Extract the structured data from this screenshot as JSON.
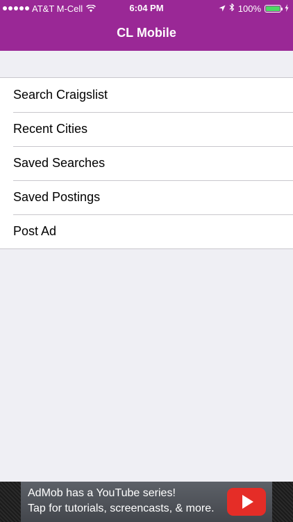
{
  "status_bar": {
    "carrier": "AT&T M-Cell",
    "time": "6:04 PM",
    "battery_percent": "100%",
    "battery_level": 1.0,
    "signal_icon": "signal-dots-icon",
    "wifi_icon": "wifi-icon",
    "location_icon": "location-arrow-icon",
    "bluetooth_icon": "bluetooth-icon",
    "charging_icon": "charging-bolt-icon"
  },
  "header": {
    "title": "CL Mobile",
    "background_color": "#9a2896"
  },
  "menu": {
    "items": [
      {
        "label": "Search Craigslist"
      },
      {
        "label": "Recent Cities"
      },
      {
        "label": "Saved Searches"
      },
      {
        "label": "Saved Postings"
      },
      {
        "label": "Post Ad"
      }
    ]
  },
  "ad": {
    "line1": "AdMob has a YouTube series!",
    "line2": "Tap for tutorials, screencasts, & more.",
    "icon": "youtube-play-icon",
    "icon_color": "#e52d27"
  }
}
